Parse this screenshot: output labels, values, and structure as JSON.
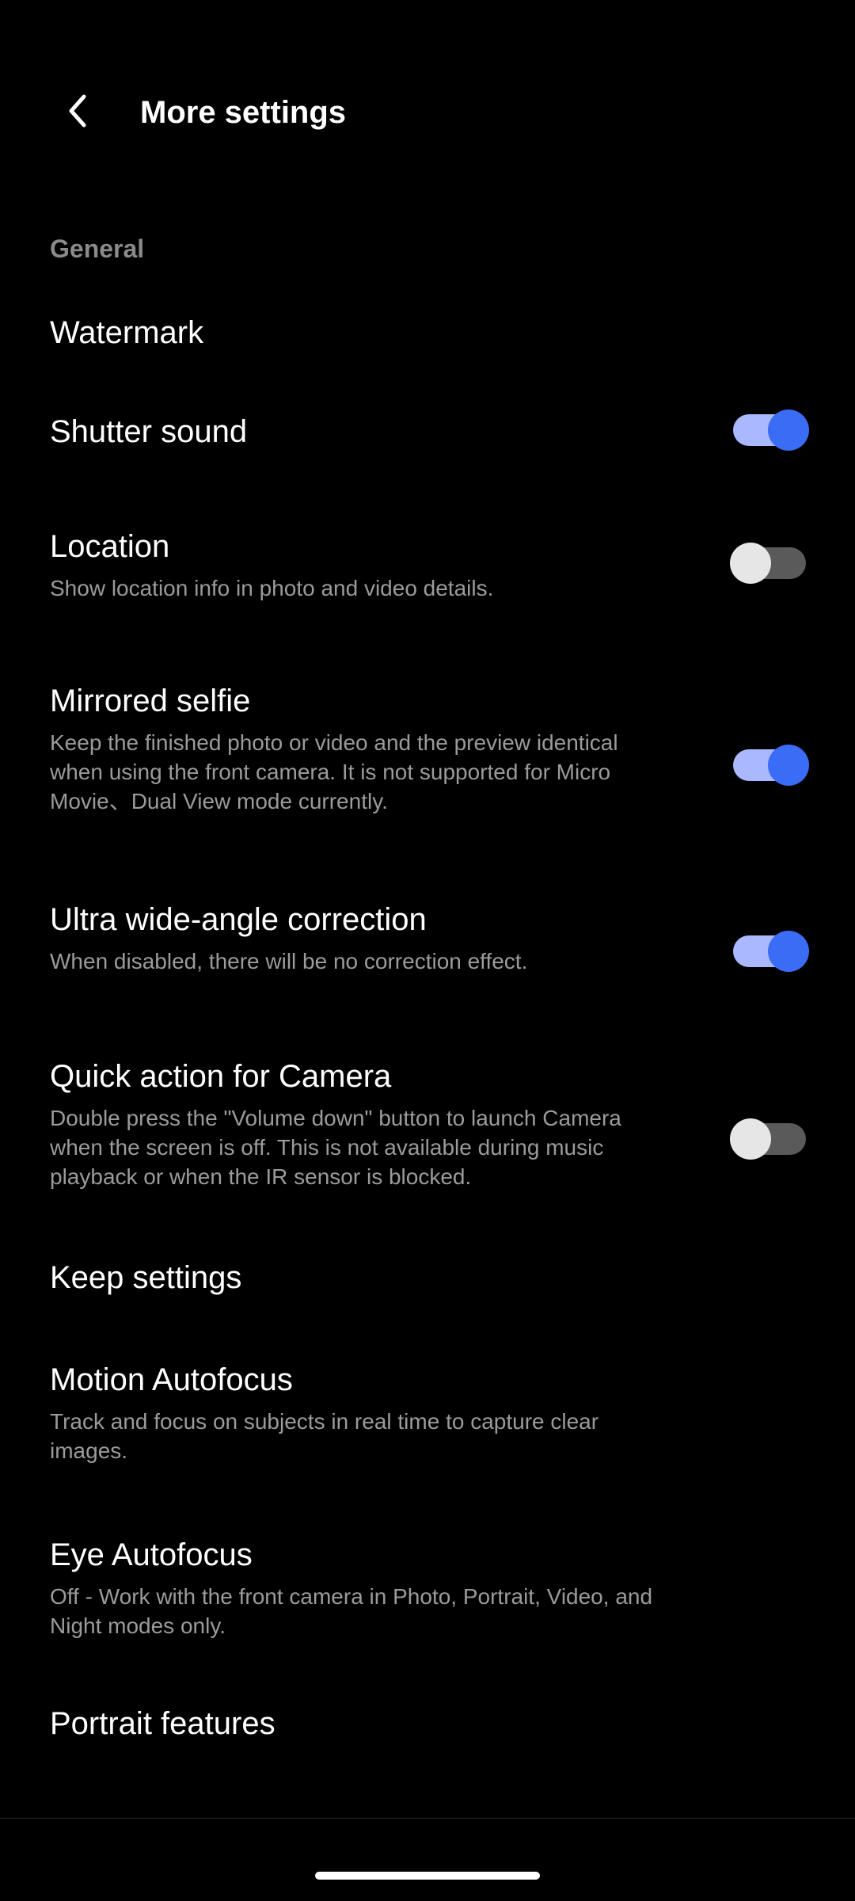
{
  "header": {
    "title": "More settings",
    "back_icon": "chevron-left-icon"
  },
  "section": {
    "general_label": "General"
  },
  "items": {
    "watermark": {
      "title": "Watermark"
    },
    "shutter_sound": {
      "title": "Shutter sound",
      "toggle": "on"
    },
    "location": {
      "title": "Location",
      "desc": "Show location info in photo and video details.",
      "toggle": "off"
    },
    "mirrored_selfie": {
      "title": "Mirrored selfie",
      "desc": "Keep the finished photo or video and the preview identical when using the front camera. It is not supported for Micro Movie、Dual View mode currently.",
      "toggle": "on"
    },
    "ultra_wide": {
      "title": "Ultra wide-angle correction",
      "desc": "When disabled, there will be no correction effect.",
      "toggle": "on"
    },
    "quick_action": {
      "title": "Quick action for Camera",
      "desc": "Double press the \"Volume down\" button to launch Camera when the screen is off. This is not available during music playback or when the IR sensor is blocked.",
      "toggle": "off"
    },
    "keep_settings": {
      "title": "Keep settings"
    },
    "motion_af": {
      "title": "Motion Autofocus",
      "desc": "Track and focus on subjects in real time to capture clear images."
    },
    "eye_af": {
      "title": "Eye Autofocus",
      "desc": "Off - Work with the front camera in Photo, Portrait, Video, and Night modes only."
    },
    "portrait": {
      "title": "Portrait features"
    }
  },
  "colors": {
    "background": "#000000",
    "accent": "#3a6cf6",
    "accent_track": "#a9b8ff",
    "secondary_text": "#9b9b9b"
  }
}
